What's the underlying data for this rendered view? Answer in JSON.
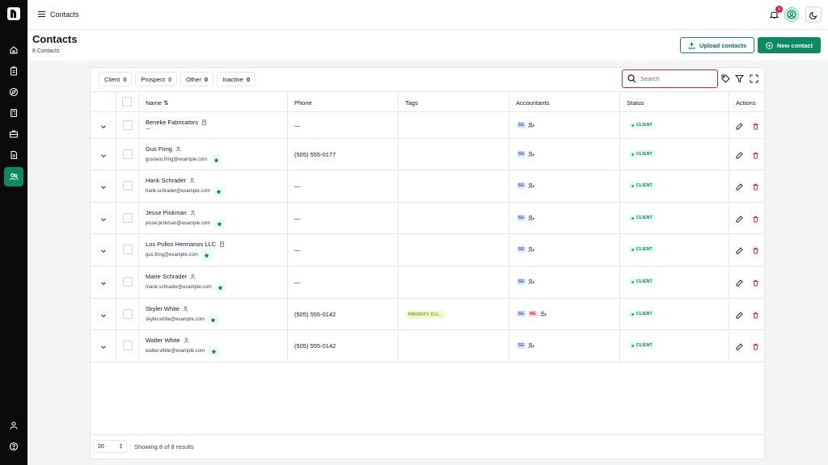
{
  "app": {
    "breadcrumb": "Contacts",
    "notification_count": "4"
  },
  "header": {
    "title": "Contacts",
    "subtitle": "8 Contacts",
    "upload_label": "Upload contacts",
    "new_label": "New contact"
  },
  "filters": [
    {
      "label": "Client",
      "count": "8"
    },
    {
      "label": "Prospect",
      "count": "0"
    },
    {
      "label": "Other",
      "count": "0"
    },
    {
      "label": "Inactive",
      "count": "0"
    }
  ],
  "search": {
    "placeholder": "Search"
  },
  "columns": {
    "name": "Name ⇅",
    "phone": "Phone",
    "tags": "Tags",
    "accountants": "Accountants",
    "status": "Status",
    "actions": "Actions"
  },
  "rows": [
    {
      "name": "Beneke Fabricators",
      "type": "company",
      "email": "—",
      "phone": "—",
      "tag": "",
      "accountants": [
        "SG"
      ],
      "status": "CLIENT"
    },
    {
      "name": "Gus Fring",
      "type": "person",
      "email": "gustavo.fring@example.com",
      "phone": "(505) 555-0177",
      "tag": "",
      "accountants": [
        "SG"
      ],
      "status": "CLIENT"
    },
    {
      "name": "Hank Schrader",
      "type": "person",
      "email": "hank.schrader@example.com",
      "phone": "—",
      "tag": "",
      "accountants": [
        "SG"
      ],
      "status": "CLIENT"
    },
    {
      "name": "Jesse Pinkman",
      "type": "person",
      "email": "jesse.pinkman@example.com",
      "phone": "—",
      "tag": "",
      "accountants": [
        "SG"
      ],
      "status": "CLIENT"
    },
    {
      "name": "Los Pollos Hermanos LLC",
      "type": "company",
      "email": "gus.fring@example.com",
      "phone": "—",
      "tag": "",
      "accountants": [
        "SG"
      ],
      "status": "CLIENT"
    },
    {
      "name": "Marie Schrader",
      "type": "person",
      "email": "marie.schrader@example.com",
      "phone": "—",
      "tag": "",
      "accountants": [
        "SG"
      ],
      "status": "CLIENT"
    },
    {
      "name": "Skyler White",
      "type": "person",
      "email": "skyler.white@example.com",
      "phone": "(505) 555-0142",
      "tag": "PRIORITY CLI...",
      "accountants": [
        "SG",
        "ME"
      ],
      "status": "CLIENT"
    },
    {
      "name": "Walter White",
      "type": "person",
      "email": "walter.white@example.com",
      "phone": "(505) 555-0142",
      "tag": "",
      "accountants": [
        "SG"
      ],
      "status": "CLIENT"
    }
  ],
  "footer": {
    "page_size": "20",
    "summary": "Showing 8 of 8 results"
  },
  "colors": {
    "brand": "#0e8a63",
    "rail": "#0b0b0b",
    "search_border": "#dc2626"
  }
}
